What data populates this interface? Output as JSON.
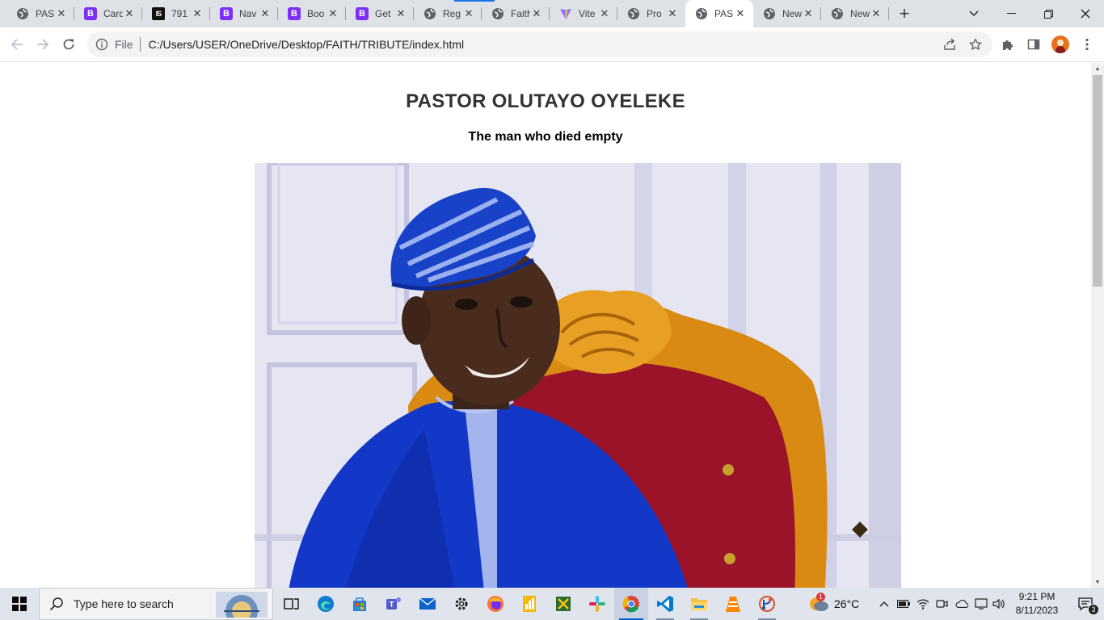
{
  "browser": {
    "tabs": [
      {
        "title": "PAS",
        "favicon": "globe-icon",
        "active": false
      },
      {
        "title": "Card",
        "favicon": "bootstrap-icon",
        "active": false
      },
      {
        "title": "791",
        "favicon": "is-icon",
        "active": false
      },
      {
        "title": "Nav",
        "favicon": "bootstrap-icon",
        "active": false
      },
      {
        "title": "Boo",
        "favicon": "bootstrap-icon",
        "active": false
      },
      {
        "title": "Get",
        "favicon": "bootstrap-icon",
        "active": false
      },
      {
        "title": "Reg",
        "favicon": "globe-icon",
        "active": false
      },
      {
        "title": "Faith",
        "favicon": "globe-icon",
        "active": false
      },
      {
        "title": "Vite",
        "favicon": "vite-icon",
        "active": false
      },
      {
        "title": "Pro",
        "favicon": "globe-icon",
        "active": false
      },
      {
        "title": "PAS",
        "favicon": "globe-icon",
        "active": true
      },
      {
        "title": "New",
        "favicon": "globe-icon",
        "active": false
      },
      {
        "title": "New",
        "favicon": "globe-icon",
        "active": false
      }
    ],
    "tab_close_glyph": "✕",
    "new_tab_glyph": "+",
    "site_info_label": "File",
    "url": "C:/Users/USER/OneDrive/Desktop/FAITH/TRIBUTE/index.html"
  },
  "page": {
    "title": "PASTOR OLUTAYO OYELEKE",
    "subtitle": "The man who died empty",
    "image_description_icon": "portrait-photo"
  },
  "taskbar": {
    "search_placeholder": "Type here to search",
    "pinned_apps": [
      {
        "name": "task-view",
        "running": false,
        "active": false
      },
      {
        "name": "edge",
        "running": false,
        "active": false
      },
      {
        "name": "microsoft-store",
        "running": false,
        "active": false
      },
      {
        "name": "teams",
        "running": false,
        "active": false
      },
      {
        "name": "mail",
        "running": false,
        "active": false
      },
      {
        "name": "settings",
        "running": false,
        "active": false
      },
      {
        "name": "firefox",
        "running": false,
        "active": false
      },
      {
        "name": "sheets",
        "running": false,
        "active": false
      },
      {
        "name": "snipping-tool",
        "running": false,
        "active": false
      },
      {
        "name": "slack",
        "running": false,
        "active": false
      },
      {
        "name": "chrome",
        "running": true,
        "active": true
      },
      {
        "name": "vscode",
        "running": true,
        "active": false
      },
      {
        "name": "file-explorer",
        "running": true,
        "active": false
      },
      {
        "name": "vlc",
        "running": false,
        "active": false
      },
      {
        "name": "git-tool",
        "running": true,
        "active": false
      }
    ],
    "weather": {
      "temperature": "26°C",
      "badge": "1"
    },
    "clock": {
      "time": "9:21 PM",
      "date": "8/11/2023"
    },
    "notification_count": "3"
  },
  "colors": {
    "tabstrip_bg": "#dee1e6",
    "accent_blue": "#1a73e8",
    "bootstrap_purple": "#7b2ff7",
    "title_text": "#333333"
  }
}
